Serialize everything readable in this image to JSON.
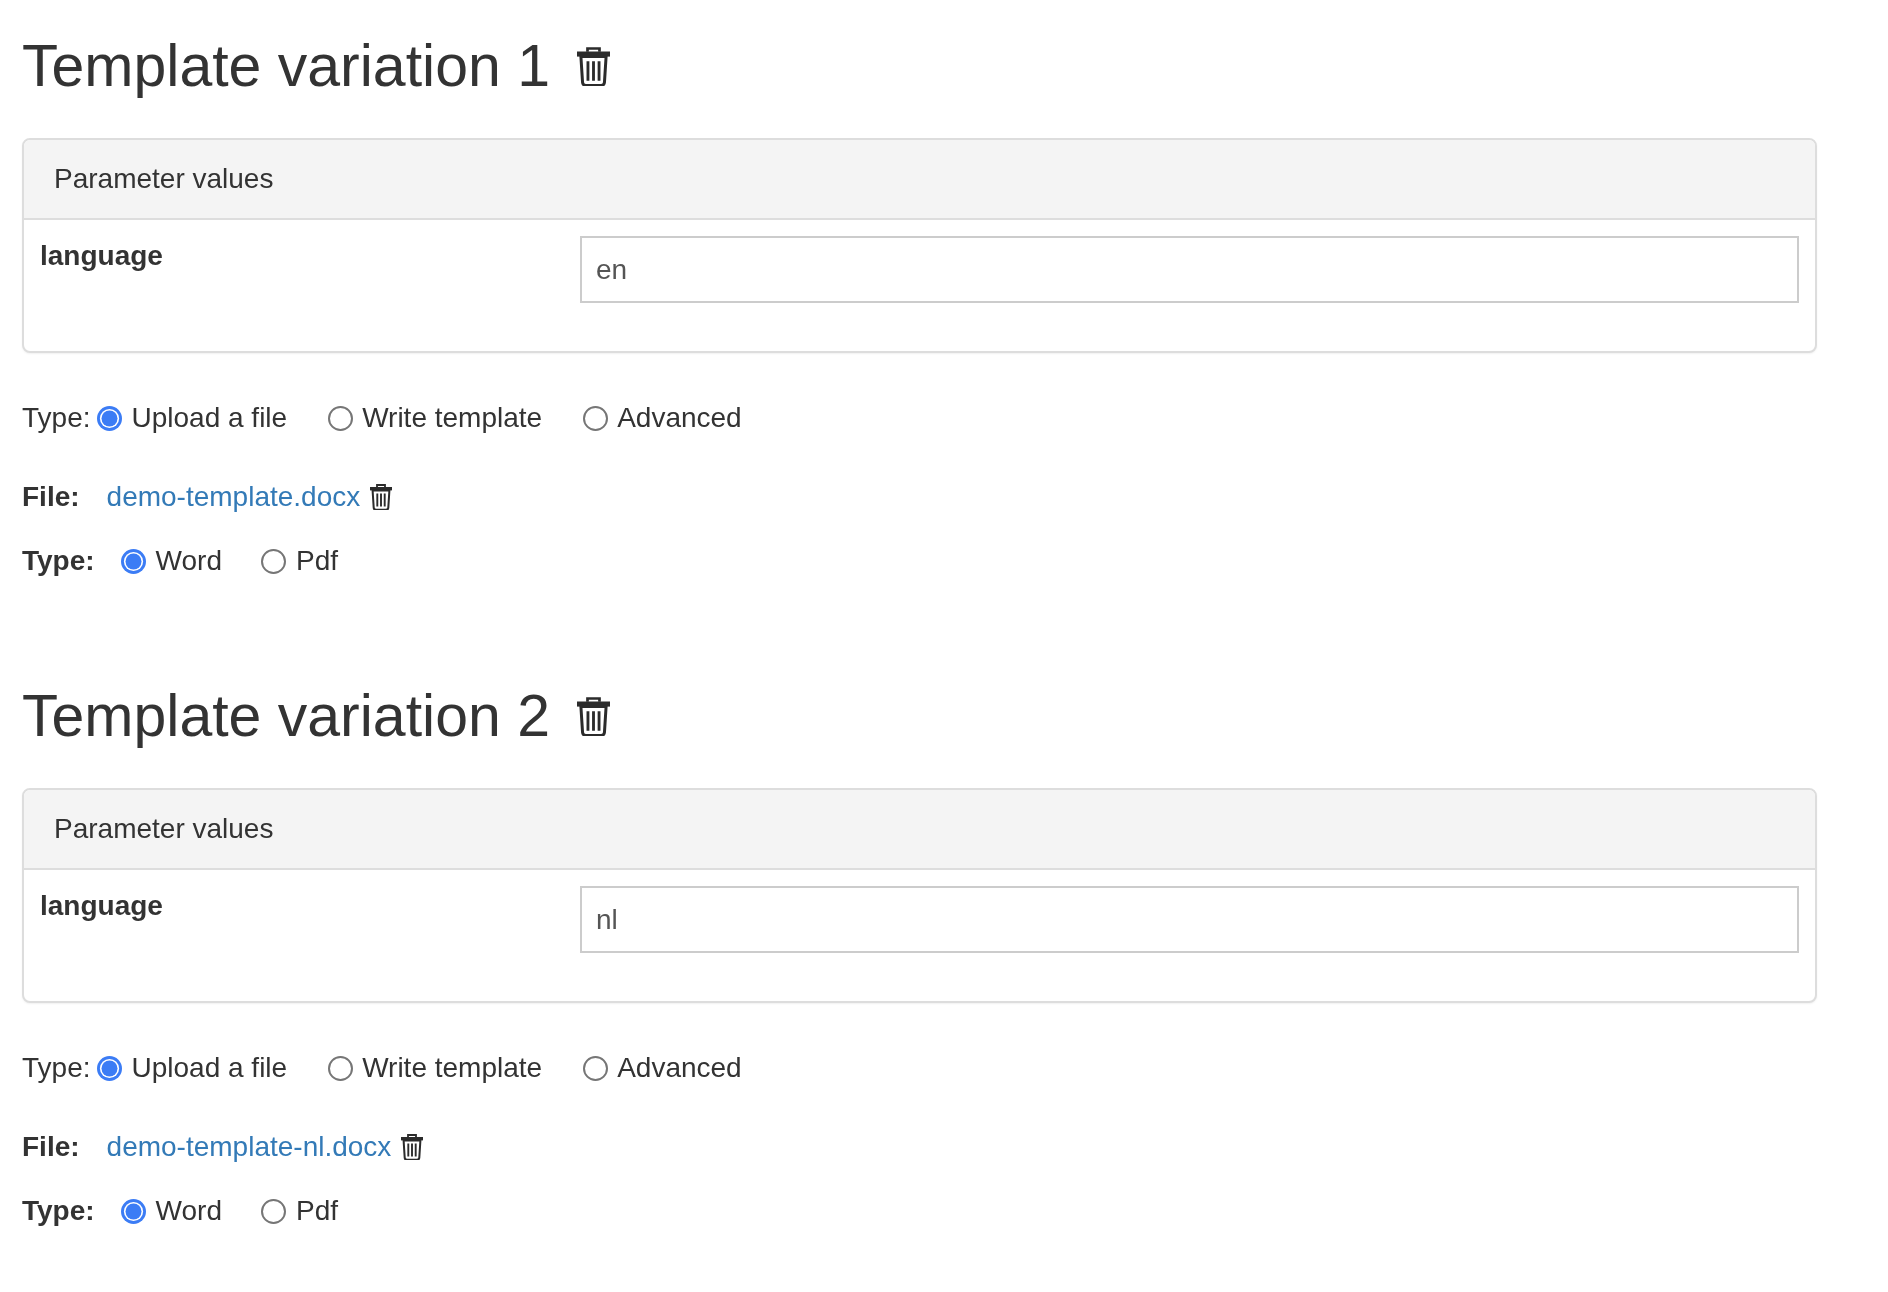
{
  "variations": [
    {
      "title": "Template variation 1",
      "parameters_panel": {
        "title": "Parameter values",
        "rows": [
          {
            "label": "language",
            "value": "en"
          }
        ]
      },
      "template_type": {
        "label": "Type:",
        "options": [
          {
            "label": "Upload a file",
            "selected": true
          },
          {
            "label": "Write template",
            "selected": false
          },
          {
            "label": "Advanced",
            "selected": false
          }
        ]
      },
      "file": {
        "label": "File:",
        "name": "demo-template.docx"
      },
      "output_type": {
        "label": "Type:",
        "options": [
          {
            "label": "Word",
            "selected": true
          },
          {
            "label": "Pdf",
            "selected": false
          }
        ]
      }
    },
    {
      "title": "Template variation 2",
      "parameters_panel": {
        "title": "Parameter values",
        "rows": [
          {
            "label": "language",
            "value": "nl"
          }
        ]
      },
      "template_type": {
        "label": "Type:",
        "options": [
          {
            "label": "Upload a file",
            "selected": true
          },
          {
            "label": "Write template",
            "selected": false
          },
          {
            "label": "Advanced",
            "selected": false
          }
        ]
      },
      "file": {
        "label": "File:",
        "name": "demo-template-nl.docx"
      },
      "output_type": {
        "label": "Type:",
        "options": [
          {
            "label": "Word",
            "selected": true
          },
          {
            "label": "Pdf",
            "selected": false
          }
        ]
      }
    }
  ]
}
